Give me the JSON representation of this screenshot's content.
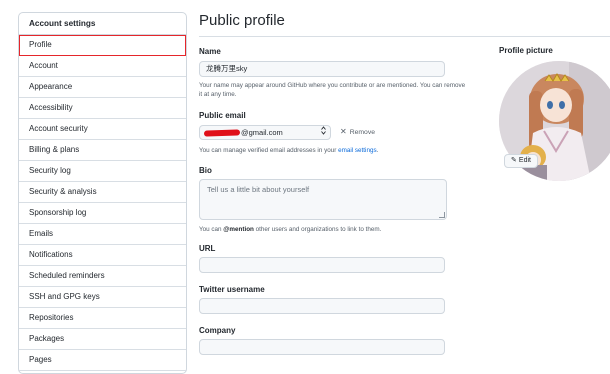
{
  "sidebar": {
    "heading": "Account settings",
    "items": [
      {
        "label": "Profile"
      },
      {
        "label": "Account"
      },
      {
        "label": "Appearance"
      },
      {
        "label": "Accessibility"
      },
      {
        "label": "Account security"
      },
      {
        "label": "Billing & plans"
      },
      {
        "label": "Security log"
      },
      {
        "label": "Security & analysis"
      },
      {
        "label": "Sponsorship log"
      },
      {
        "label": "Emails"
      },
      {
        "label": "Notifications"
      },
      {
        "label": "Scheduled reminders"
      },
      {
        "label": "SSH and GPG keys"
      },
      {
        "label": "Repositories"
      },
      {
        "label": "Packages"
      },
      {
        "label": "Pages"
      }
    ]
  },
  "main": {
    "title": "Public profile",
    "name": {
      "label": "Name",
      "value": "龙腾万里sky",
      "help": "Your name may appear around GitHub where you contribute or are mentioned. You can remove it at any time."
    },
    "public_email": {
      "label": "Public email",
      "value_suffix": "@gmail.com",
      "remove_label": "Remove",
      "help_prefix": "You can manage verified email addresses in your ",
      "help_link": "email settings",
      "help_suffix": "."
    },
    "bio": {
      "label": "Bio",
      "placeholder": "Tell us a little bit about yourself",
      "help_prefix": "You can ",
      "help_mention": "@mention",
      "help_suffix": " other users and organizations to link to them."
    },
    "url": {
      "label": "URL",
      "value": ""
    },
    "twitter": {
      "label": "Twitter username",
      "value": ""
    },
    "company": {
      "label": "Company",
      "value": ""
    }
  },
  "profile_picture": {
    "label": "Profile picture",
    "edit_label": "Edit"
  },
  "colors": {
    "accent": "#0969da",
    "selection_outline": "#e5262b",
    "redaction": "#e0101a"
  }
}
